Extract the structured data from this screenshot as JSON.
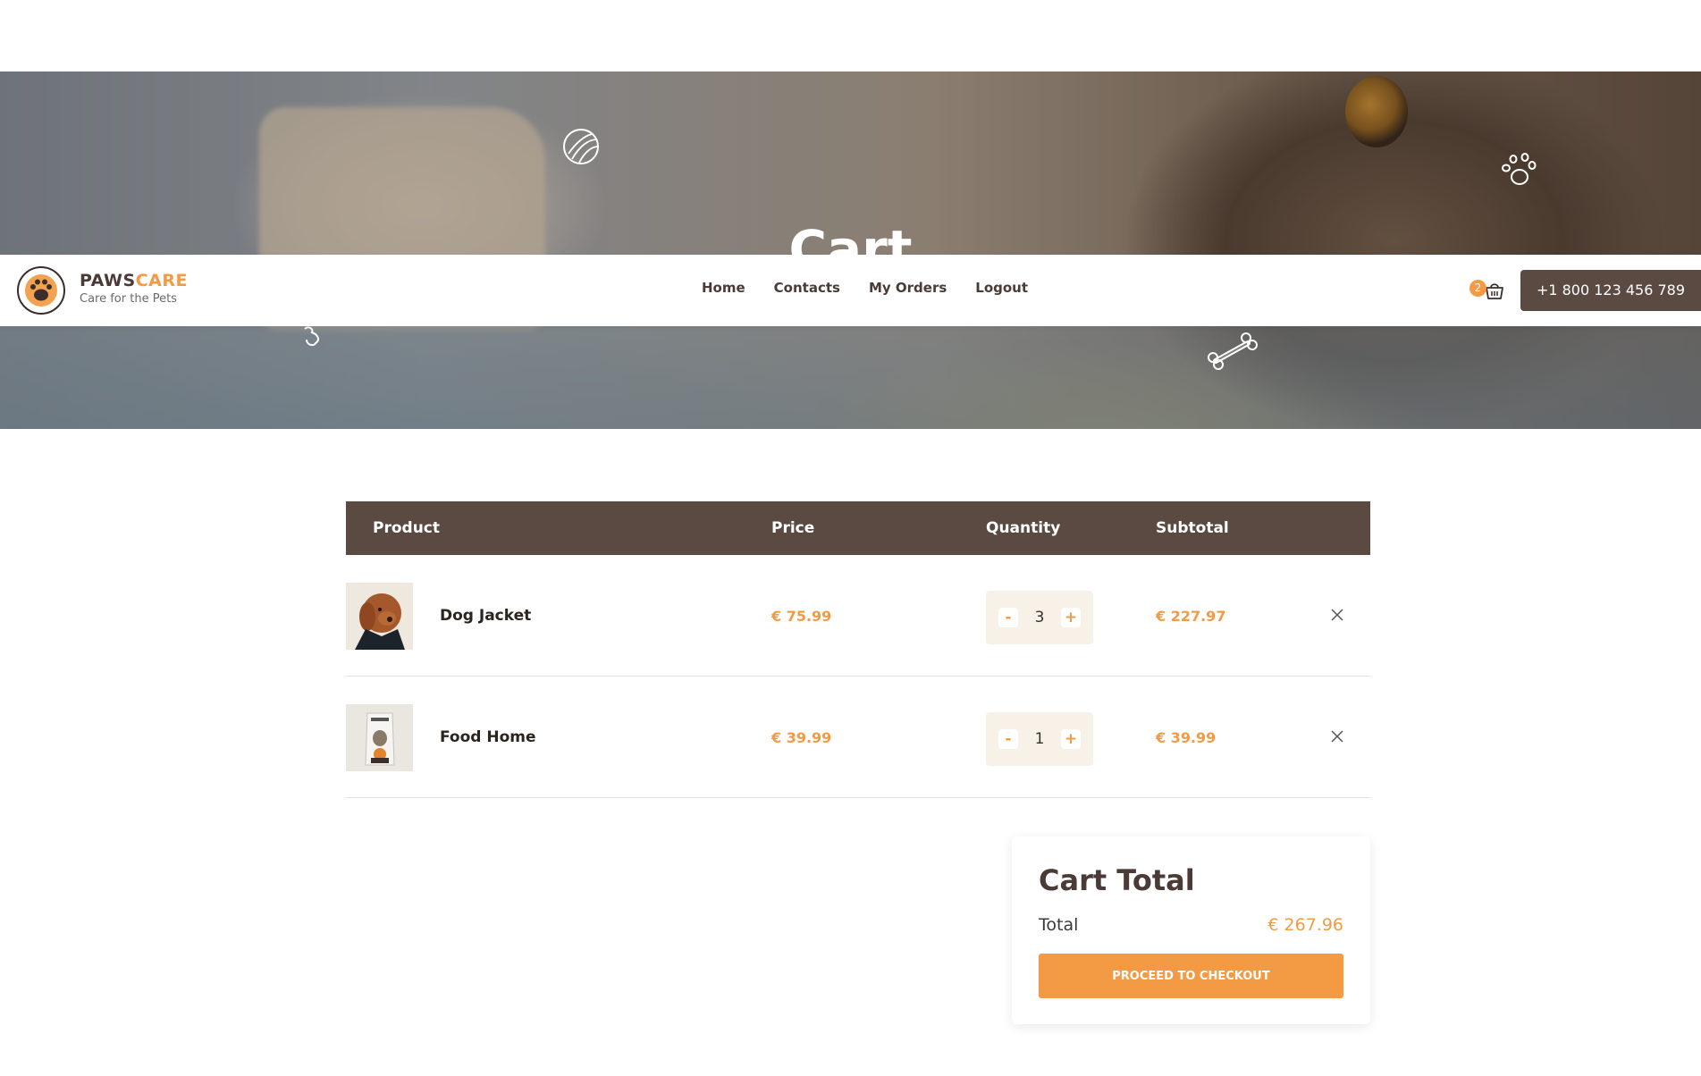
{
  "brand": {
    "name_part1": "PAWS",
    "name_part2": "CARE",
    "tagline": "Care for the Pets"
  },
  "hero": {
    "title": "Cart"
  },
  "nav": {
    "items": [
      {
        "label": "Home"
      },
      {
        "label": "Contacts"
      },
      {
        "label": "My Orders"
      },
      {
        "label": "Logout"
      }
    ]
  },
  "header": {
    "cart_count": "2",
    "phone": "+1 800 123 456 789"
  },
  "table": {
    "headers": {
      "product": "Product",
      "price": "Price",
      "quantity": "Quantity",
      "subtotal": "Subtotal"
    },
    "rows": [
      {
        "name": "Dog Jacket",
        "price": "€ 75.99",
        "quantity": "3",
        "subtotal": "€ 227.97",
        "minus": "-",
        "plus": "+"
      },
      {
        "name": "Food Home",
        "price": "€ 39.99",
        "quantity": "1",
        "subtotal": "€ 39.99",
        "minus": "-",
        "plus": "+"
      }
    ]
  },
  "cart_total": {
    "title": "Cart Total",
    "total_label": "Total",
    "total_value": "€ 267.96",
    "checkout_label": "PROCEED TO CHECKOUT"
  },
  "colors": {
    "accent": "#f39a45",
    "dark_brown": "#5a4a42",
    "qty_bg": "#f8f1e8"
  },
  "icons": [
    "paw-logo-icon",
    "cart-icon",
    "close-icon",
    "yarn-ball-icon",
    "paw-print-icon",
    "bone-icon"
  ]
}
